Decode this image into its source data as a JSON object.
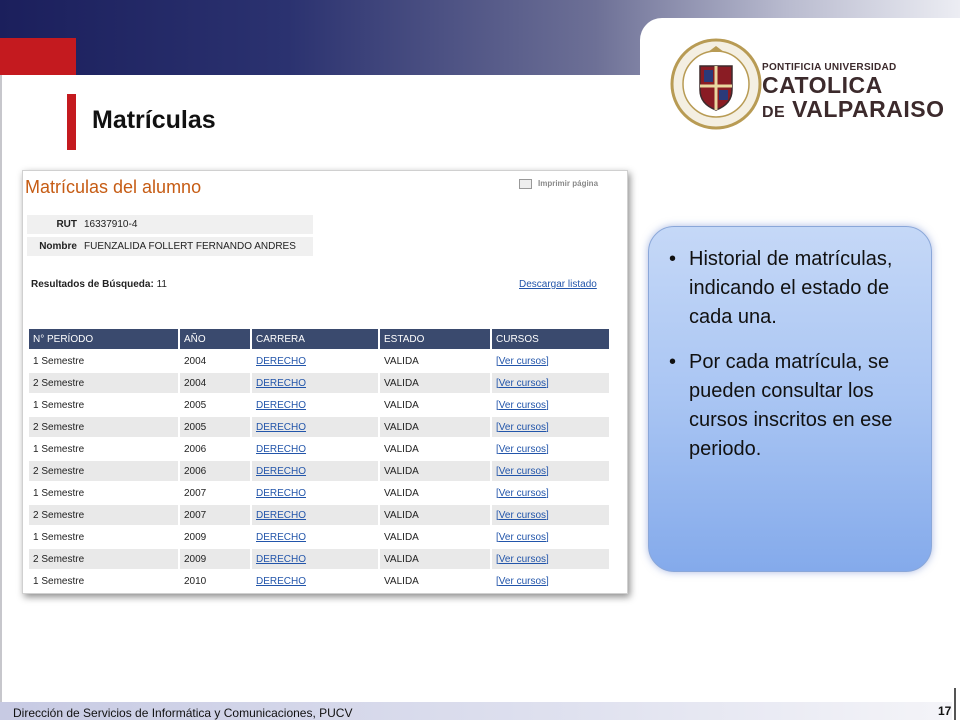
{
  "slide": {
    "title": "Matrículas"
  },
  "logo": {
    "line1": "PONTIFICIA UNIVERSIDAD",
    "line2": "CATOLICA",
    "line3_prefix": "DE",
    "line3": "VALPARAISO"
  },
  "screenshot": {
    "title": "Matrículas del alumno",
    "print_label": "Imprimir página",
    "rut_label": "RUT",
    "rut_value": "16337910-4",
    "name_label": "Nombre",
    "name_value": "FUENZALIDA FOLLERT FERNANDO ANDRES",
    "results_label": "Resultados de Búsqueda:",
    "results_count": "11",
    "download_label": "Descargar listado",
    "columns": [
      "N° PERÍODO",
      "AÑO",
      "CARRERA",
      "ESTADO",
      "CURSOS"
    ],
    "rows": [
      [
        "1 Semestre",
        "2004",
        "DERECHO",
        "VALIDA",
        "[Ver cursos]"
      ],
      [
        "2 Semestre",
        "2004",
        "DERECHO",
        "VALIDA",
        "[Ver cursos]"
      ],
      [
        "1 Semestre",
        "2005",
        "DERECHO",
        "VALIDA",
        "[Ver cursos]"
      ],
      [
        "2 Semestre",
        "2005",
        "DERECHO",
        "VALIDA",
        "[Ver cursos]"
      ],
      [
        "1 Semestre",
        "2006",
        "DERECHO",
        "VALIDA",
        "[Ver cursos]"
      ],
      [
        "2 Semestre",
        "2006",
        "DERECHO",
        "VALIDA",
        "[Ver cursos]"
      ],
      [
        "1 Semestre",
        "2007",
        "DERECHO",
        "VALIDA",
        "[Ver cursos]"
      ],
      [
        "2 Semestre",
        "2007",
        "DERECHO",
        "VALIDA",
        "[Ver cursos]"
      ],
      [
        "1 Semestre",
        "2009",
        "DERECHO",
        "VALIDA",
        "[Ver cursos]"
      ],
      [
        "2 Semestre",
        "2009",
        "DERECHO",
        "VALIDA",
        "[Ver cursos]"
      ],
      [
        "1 Semestre",
        "2010",
        "DERECHO",
        "VALIDA",
        "[Ver cursos]"
      ]
    ]
  },
  "callout": {
    "bullets": [
      "Historial de matrículas, indicando el estado de cada una.",
      "Por cada matrícula, se pueden consultar los cursos inscritos en ese periodo."
    ]
  },
  "footer": {
    "text": "Dirección de Servicios de Informática y Comunicaciones, PUCV",
    "page": "17"
  },
  "colors": {
    "brand_red": "#c41a1f",
    "brand_navy": "#1b1f5c",
    "table_header": "#3a4a6e",
    "link": "#2255aa",
    "title_orange": "#c65c14"
  }
}
